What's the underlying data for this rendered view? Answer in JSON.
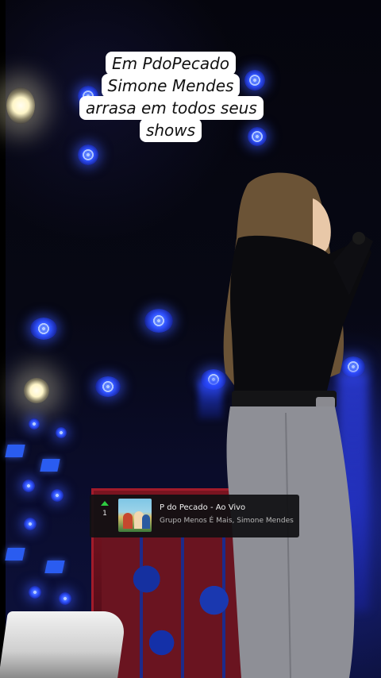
{
  "caption": {
    "lines": [
      "Em PdoPecado",
      "Simone Mendes",
      "arrasa em todos seus",
      "shows"
    ]
  },
  "music_sticker": {
    "rank": "1",
    "trend": "up-arrow-icon",
    "song_title": "P do Pecado - Ao Vivo",
    "artists": "Grupo Menos É Mais, Simone Mendes"
  },
  "colors": {
    "stage_blue": "#2f52ff",
    "caption_bg": "#ffffff",
    "caption_text": "#111111",
    "sticker_bg": "#101012",
    "trend_green": "#2ecc40",
    "set_red": "#a21b2a"
  }
}
